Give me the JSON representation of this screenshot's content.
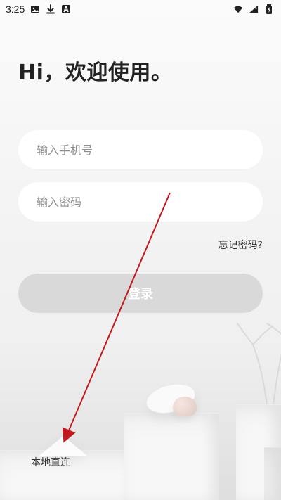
{
  "status_bar": {
    "time": "3:25",
    "icons": [
      "image-icon",
      "download-icon",
      "text-a-icon",
      "wifi-icon",
      "signal-icon",
      "battery-charging-icon"
    ]
  },
  "welcome": {
    "title": "Hi，欢迎使用。"
  },
  "login_form": {
    "phone_placeholder": "输入手机号",
    "password_placeholder": "输入密码",
    "forgot_password": "忘记密码?",
    "login_button": "登录"
  },
  "footer": {
    "local_connect": "本地直连"
  },
  "annotation": {
    "arrow_color": "#c2181f"
  },
  "theme": {
    "button_disabled": "#d9d9d9",
    "text_primary": "#222222"
  }
}
